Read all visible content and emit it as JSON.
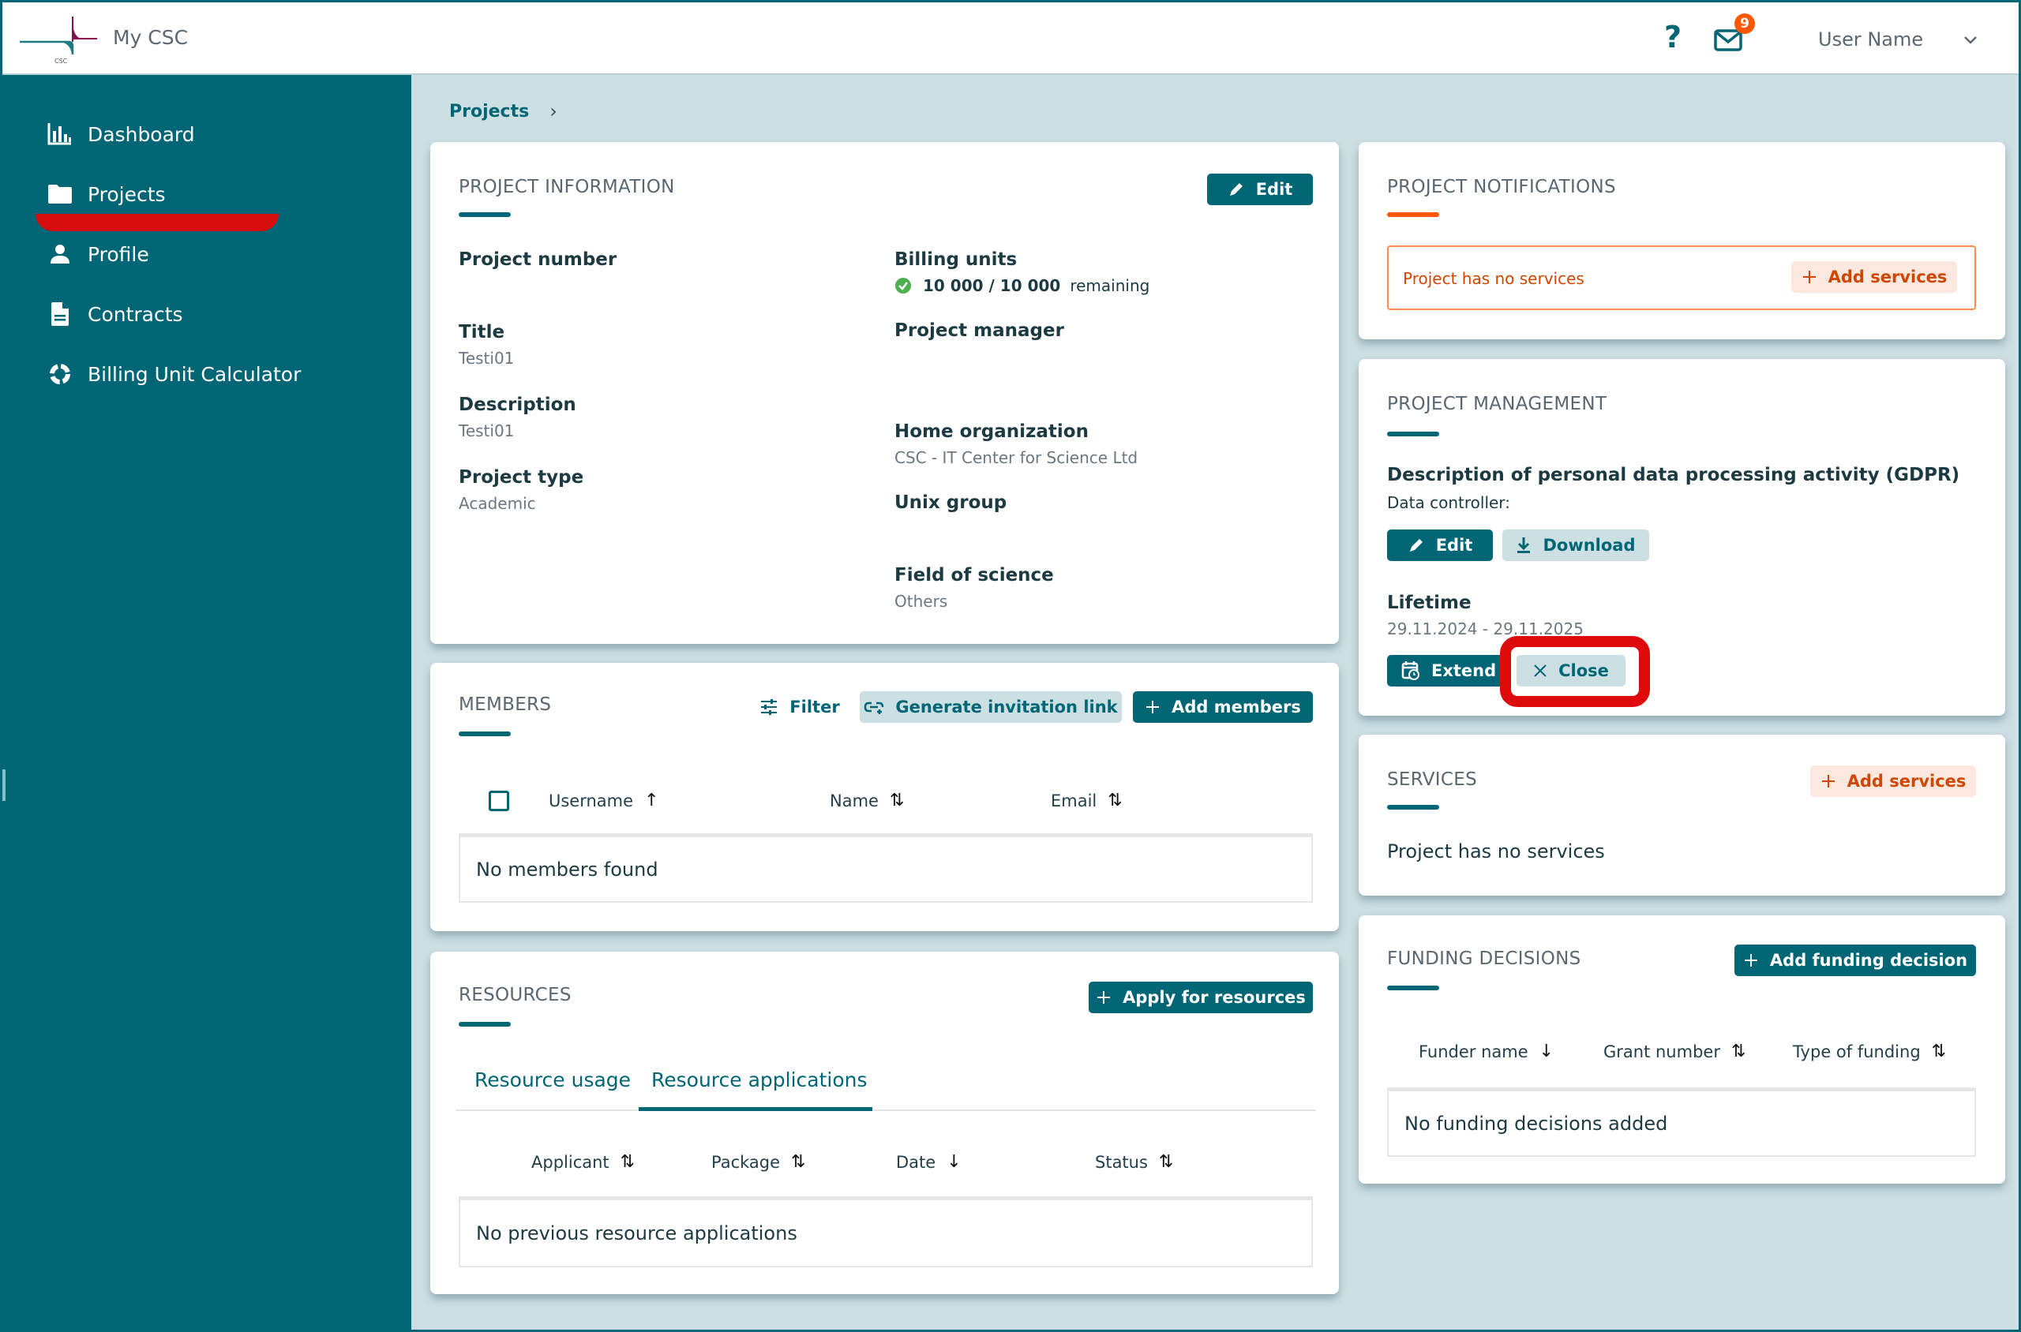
{
  "header": {
    "app_name": "My CSC",
    "logo_text": "CSC",
    "help_label": "?",
    "mail_badge_count": "9",
    "user_name": "User Name"
  },
  "sidebar": {
    "items": [
      {
        "label": "Dashboard",
        "icon": "bar-chart-icon"
      },
      {
        "label": "Projects",
        "icon": "folder-icon",
        "active": true
      },
      {
        "label": "Profile",
        "icon": "person-icon"
      },
      {
        "label": "Contracts",
        "icon": "document-icon"
      },
      {
        "label": "Billing Unit Calculator",
        "icon": "calculator-cycle-icon"
      }
    ]
  },
  "breadcrumb": {
    "items": [
      "Projects"
    ],
    "separator": "›"
  },
  "project_information": {
    "title": "PROJECT INFORMATION",
    "edit_label": "Edit",
    "fields_left": [
      {
        "label": "Project number",
        "value": ""
      },
      {
        "label": "Title",
        "value": "Testi01"
      },
      {
        "label": "Description",
        "value": "Testi01"
      },
      {
        "label": "Project type",
        "value": "Academic"
      }
    ],
    "billing_units": {
      "label": "Billing units",
      "value": "10 000 / 10 000",
      "suffix": "remaining",
      "remaining_fraction": 1.0
    },
    "fields_right": [
      {
        "label": "Project manager",
        "value": ""
      },
      {
        "label": "Home organization",
        "value": "CSC - IT Center for Science Ltd"
      },
      {
        "label": "Unix group",
        "value": ""
      },
      {
        "label": "Field of science",
        "value": "Others"
      }
    ]
  },
  "members": {
    "title": "MEMBERS",
    "filter_label": "Filter",
    "generate_link_label": "Generate invitation link",
    "add_members_label": "Add members",
    "columns": [
      {
        "label": "Username",
        "sort": "asc"
      },
      {
        "label": "Name",
        "sort": "both"
      },
      {
        "label": "Email",
        "sort": "both"
      }
    ],
    "empty_text": "No members found"
  },
  "resources": {
    "title": "RESOURCES",
    "apply_label": "Apply for resources",
    "tabs": [
      {
        "label": "Resource usage",
        "active": false
      },
      {
        "label": "Resource applications",
        "active": true
      }
    ],
    "columns": [
      {
        "label": "Applicant",
        "sort": "both"
      },
      {
        "label": "Package",
        "sort": "both"
      },
      {
        "label": "Date",
        "sort": "desc"
      },
      {
        "label": "Status",
        "sort": "both"
      }
    ],
    "empty_text": "No previous resource applications"
  },
  "notifications": {
    "title": "PROJECT NOTIFICATIONS",
    "message": "Project has no services",
    "add_services_label": "Add services"
  },
  "management": {
    "title": "PROJECT MANAGEMENT",
    "gdpr_label": "Description of personal data processing activity (GDPR)",
    "data_controller_label": "Data controller:",
    "edit_label": "Edit",
    "download_label": "Download",
    "lifetime_label": "Lifetime",
    "lifetime_value": "29.11.2024 - 29.11.2025",
    "extend_label": "Extend",
    "close_label": "Close"
  },
  "services": {
    "title": "SERVICES",
    "add_services_label": "Add services",
    "empty_text": "Project has no services"
  },
  "funding": {
    "title": "FUNDING DECISIONS",
    "add_label": "Add funding decision",
    "columns": [
      {
        "label": "Funder name",
        "sort": "desc"
      },
      {
        "label": "Grant number",
        "sort": "both"
      },
      {
        "label": "Type of funding",
        "sort": "both"
      }
    ],
    "empty_text": "No funding decisions added"
  },
  "sort_glyphs": {
    "asc": "↑",
    "desc": "↓",
    "both": "⇅"
  },
  "colors": {
    "brand": "#006675",
    "accent_warn": "#ff5800",
    "highlight": "#dd0b0b",
    "success": "#4caf50"
  }
}
